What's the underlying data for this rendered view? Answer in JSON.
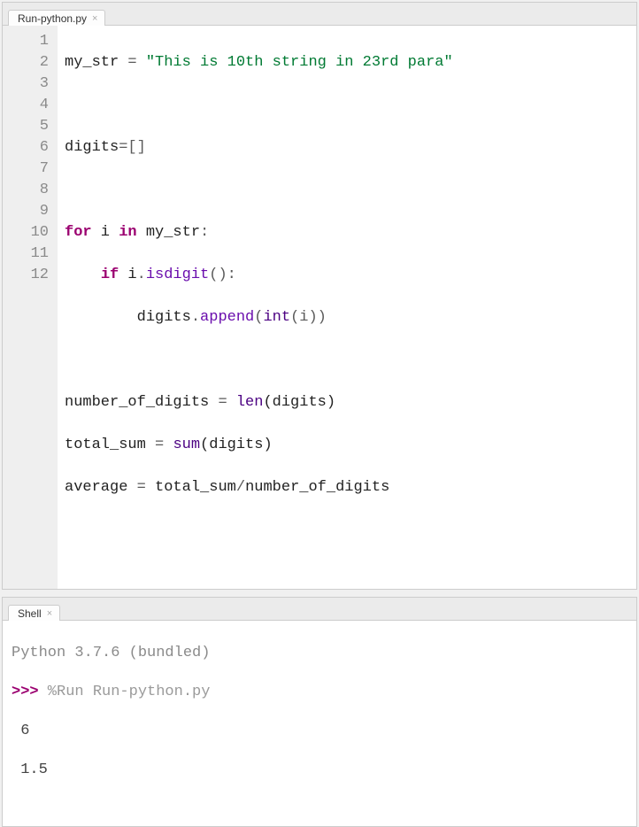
{
  "editor": {
    "tab_label": "Run-python.py",
    "line_numbers": [
      "1",
      "2",
      "3",
      "4",
      "5",
      "6",
      "7",
      "8",
      "9",
      "10",
      "11",
      "12"
    ],
    "lines": {
      "l1": {
        "a": "my_str ",
        "op1": "=",
        "b": " ",
        "str": "\"This is 10th string in 23rd para\""
      },
      "l2": "",
      "l3": {
        "a": "digits",
        "op": "=[]"
      },
      "l4": "",
      "l5": {
        "kw1": "for",
        "a": " i ",
        "kw2": "in",
        "b": " my_str",
        "c": ":"
      },
      "l6": {
        "indent": "    ",
        "kw": "if",
        "a": " i",
        "dot": ".",
        "fn": "isdigit",
        "p": "():"
      },
      "l7": {
        "indent": "        ",
        "a": "digits",
        "dot": ".",
        "fn": "append",
        "p1": "(",
        "bi": "int",
        "p2": "(i))"
      },
      "l8": "",
      "l9": {
        "a": "number_of_digits ",
        "op": "=",
        "b": " ",
        "bi": "len",
        "p": "(digits)"
      },
      "l10": {
        "a": "total_sum ",
        "op": "=",
        "b": " ",
        "bi": "sum",
        "p": "(digits)"
      },
      "l11": {
        "a": "average ",
        "op": "=",
        "b": " total_sum",
        "op2": "/",
        "c": "number_of_digits"
      },
      "l12": ""
    }
  },
  "shell": {
    "tab_label": "Shell",
    "version_line": "Python 3.7.6 (bundled)",
    "prompt": ">>>",
    "run_cmd": " %Run Run-python.py",
    "output1": " 6",
    "output2": " 1.5"
  }
}
